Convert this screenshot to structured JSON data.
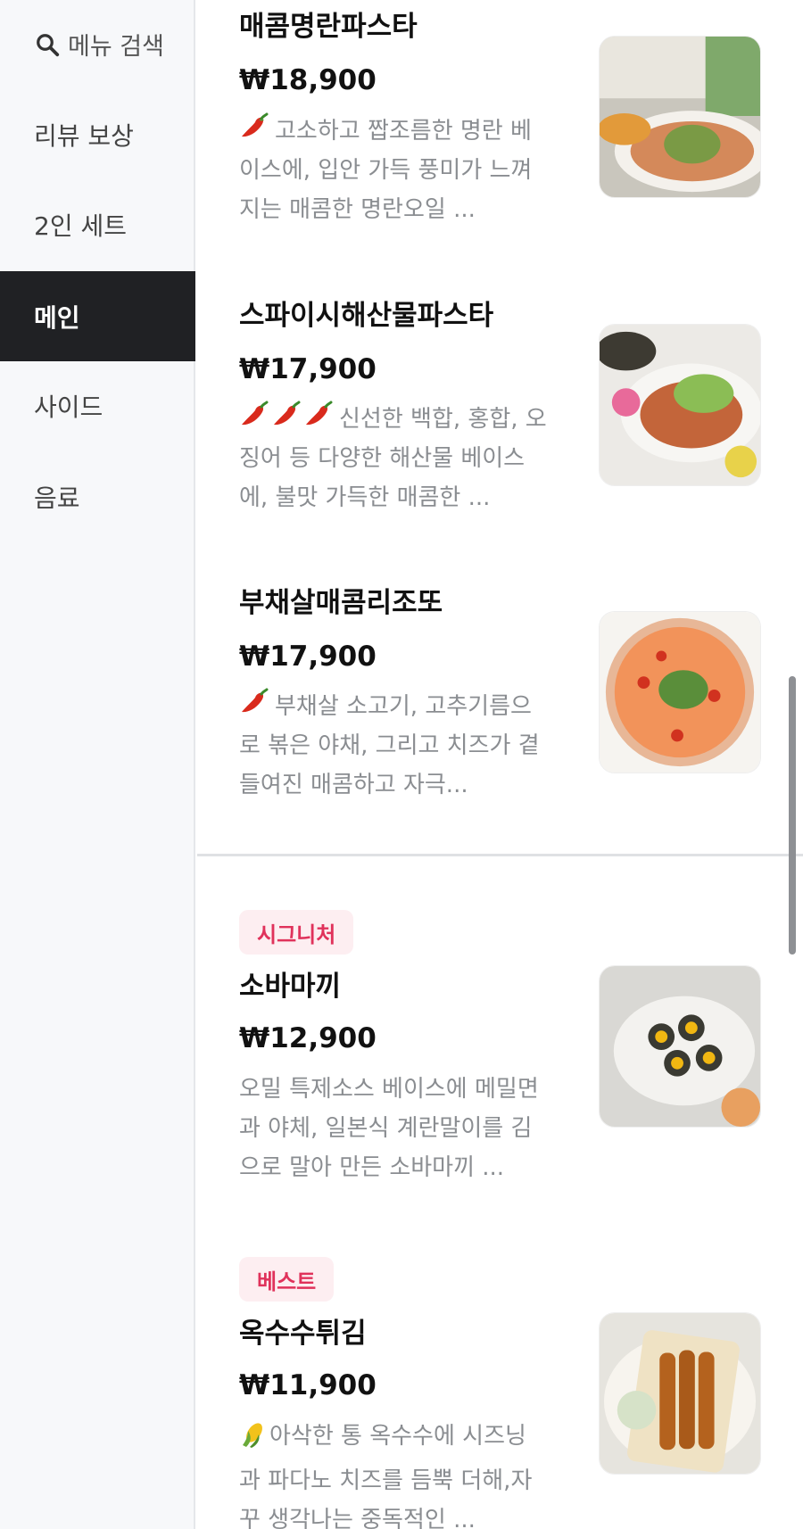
{
  "sidebar": {
    "search_label": "메뉴 검색",
    "items": [
      {
        "label": "리뷰 보상",
        "active": false
      },
      {
        "label": "2인 세트",
        "active": false
      },
      {
        "label": "메인",
        "active": true
      },
      {
        "label": "사이드",
        "active": false
      },
      {
        "label": "음료",
        "active": false
      }
    ]
  },
  "menu": {
    "items": [
      {
        "badge": "",
        "name": "매콤명란파스타",
        "price": "₩18,900",
        "desc_icon": "chili-pepper-icon",
        "desc_icon_count": 1,
        "description": "고소하고 짭조름한 명란 베이스에, 입안 가득 풍미가 느껴지는 매콤한 명란오일 ...",
        "image": "spicy-mentaiko-pasta-photo"
      },
      {
        "badge": "",
        "name": "스파이시해산물파스타",
        "price": "₩17,900",
        "desc_icon": "chili-pepper-icon",
        "desc_icon_count": 3,
        "description": "신선한 백합, 홍합, 오징어 등 다양한 해산물 베이스에, 불맛 가득한 매콤한 ...",
        "image": "spicy-seafood-pasta-photo"
      },
      {
        "badge": "",
        "name": "부채살매콤리조또",
        "price": "₩17,900",
        "desc_icon": "chili-pepper-icon",
        "desc_icon_count": 1,
        "description": "부채살 소고기, 고추기름으로 볶은 야채, 그리고 치즈가 곁들여진 매콤하고 자극...",
        "image": "spicy-risotto-photo"
      },
      {
        "badge": "시그니처",
        "name": "소바마끼",
        "price": "₩12,900",
        "desc_icon": "",
        "desc_icon_count": 0,
        "description": "오밀 특제소스 베이스에 메밀면과 야체, 일본식 계란말이를 김으로 말아 만든 소바마끼 ...",
        "image": "soba-maki-photo"
      },
      {
        "badge": "베스트",
        "name": "옥수수튀김",
        "price": "₩11,900",
        "desc_icon": "corn-icon",
        "desc_icon_count": 1,
        "description": "아삭한 통 옥수수에 시즈닝과 파다노 치즈를 듬뿍 더해,자꾸 생각나는 중독적인 ...",
        "image": "fried-corn-photo"
      }
    ]
  },
  "colors": {
    "active_tab_bg": "#202124",
    "badge_bg": "#fdeef1",
    "badge_text": "#e0325b",
    "description_text": "#8a8d91",
    "sidebar_bg": "#f7f8fa"
  }
}
